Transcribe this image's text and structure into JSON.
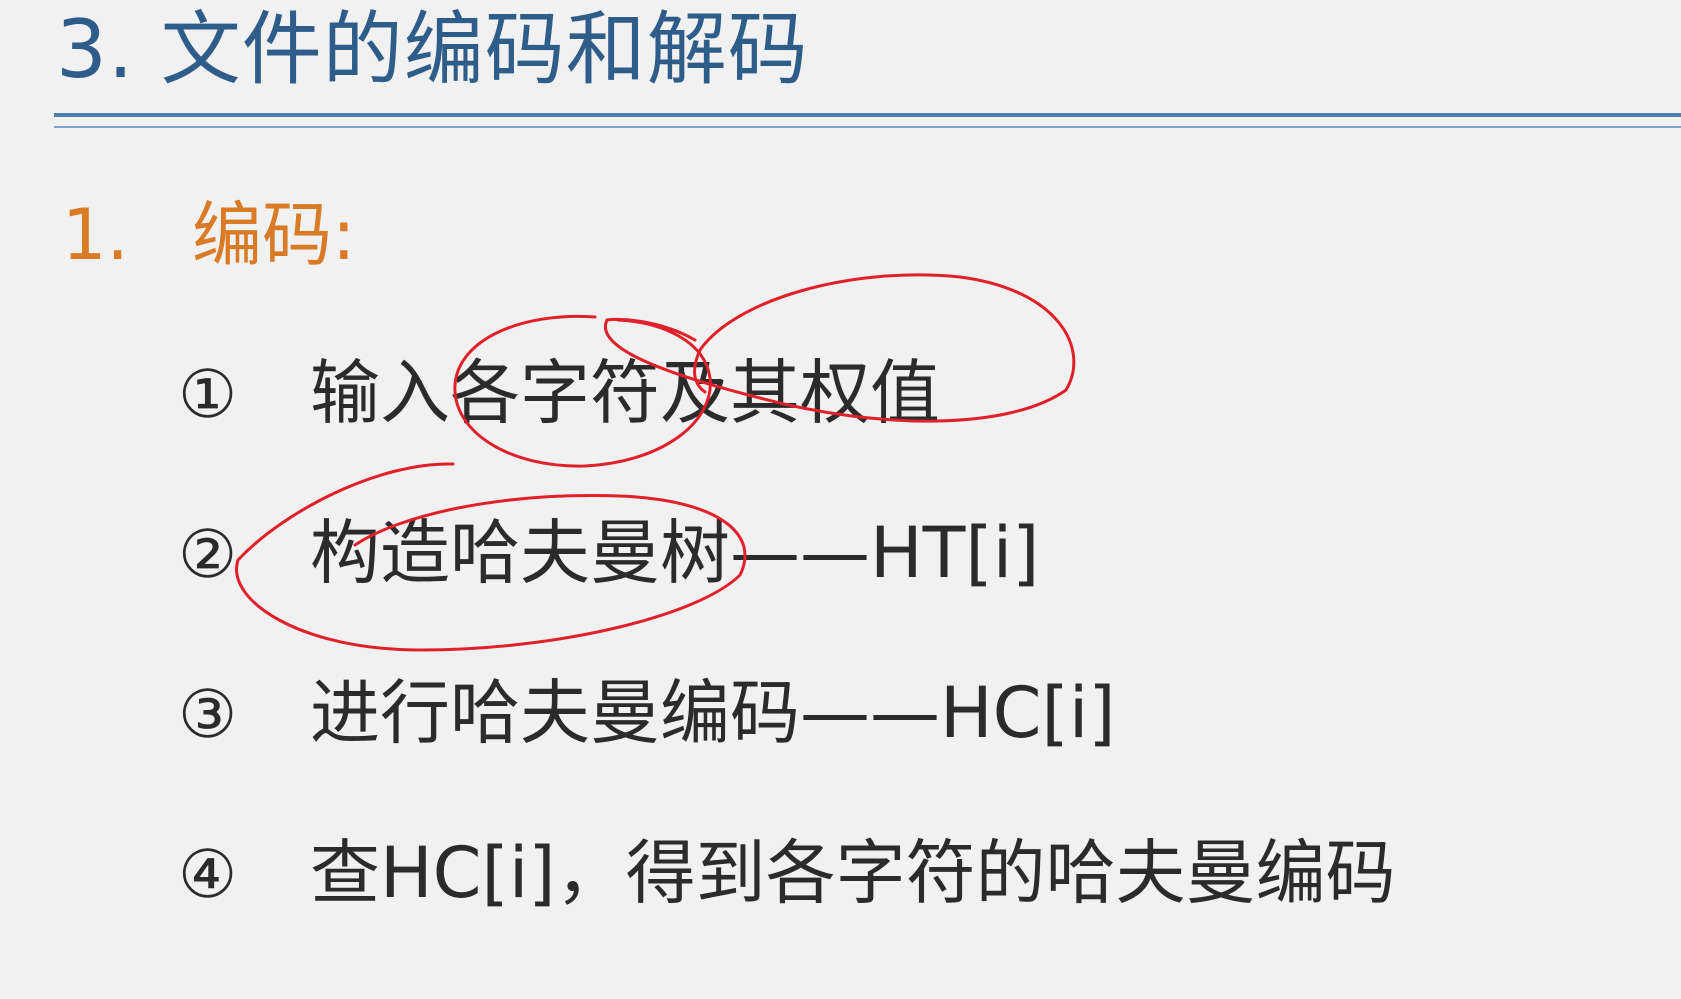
{
  "title": "3. 文件的编码和解码",
  "section": {
    "number": "1.",
    "label": "编码:"
  },
  "items": [
    {
      "marker": "①",
      "text": "输入各字符及其权值"
    },
    {
      "marker": "②",
      "text": "构造哈夫曼树——HT[i]"
    },
    {
      "marker": "③",
      "text": "进行哈夫曼编码——HC[i]"
    },
    {
      "marker": "④",
      "text": "查HC[i]，得到各字符的哈夫曼编码"
    }
  ],
  "colors": {
    "title": "#2f5d8a",
    "section": "#d97a26",
    "body_text": "#2b2b2b",
    "annotation_ink": "#e0202a",
    "background": "#f1f1f1"
  }
}
